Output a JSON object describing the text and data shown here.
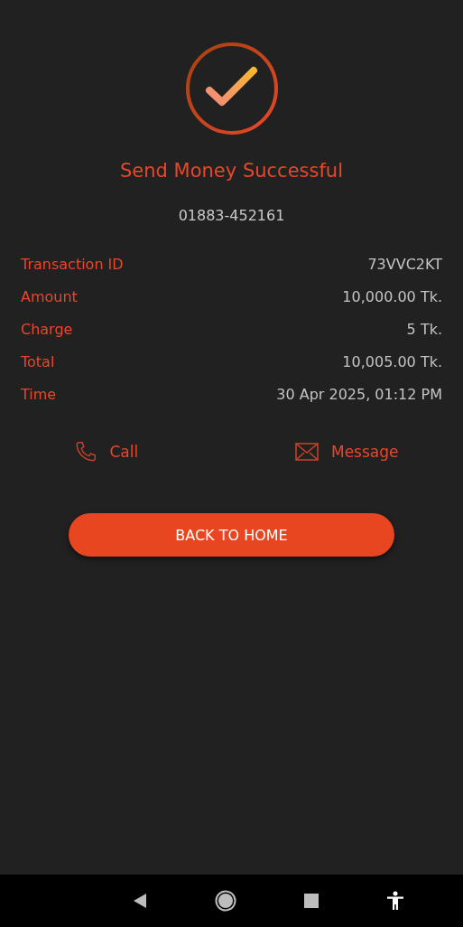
{
  "title": "Send Money Successful",
  "phone": "01883-452161",
  "details": [
    {
      "label": "Transaction ID",
      "value": "73VVC2KT"
    },
    {
      "label": "Amount",
      "value": "10,000.00 Tk."
    },
    {
      "label": "Charge",
      "value": "5 Tk."
    },
    {
      "label": "Total",
      "value": "10,005.00 Tk."
    },
    {
      "label": "Time",
      "value": "30 Apr 2025, 01:12 PM"
    }
  ],
  "actions": [
    {
      "kind": "call",
      "label": "Call"
    },
    {
      "kind": "message",
      "label": "Message"
    }
  ],
  "primary_button": "BACK TO HOME"
}
